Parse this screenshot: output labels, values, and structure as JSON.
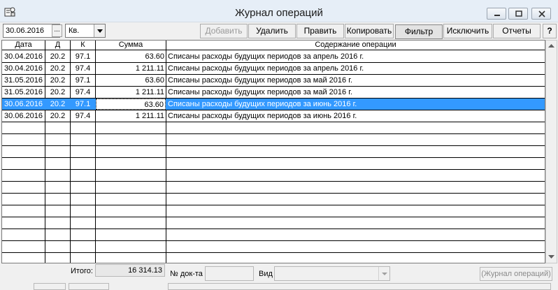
{
  "window": {
    "title": "Журнал операций"
  },
  "toolbar": {
    "date_value": "30.06.2016",
    "dots_label": "...",
    "period_value": "Кв.",
    "buttons": [
      "Добавить",
      "Удалить",
      "Править",
      "Копировать",
      "Фильтр",
      "Исключить",
      "Отчеты"
    ],
    "help_label": "?"
  },
  "grid": {
    "columns": [
      "Дата",
      "Д",
      "К",
      "Сумма",
      "Содержание операции"
    ],
    "rows": [
      {
        "date": "30.04.2016",
        "d": "20.2",
        "k": "97.1",
        "sum": "63.60",
        "text": "Списаны расходы будущих периодов за апрель 2016 г."
      },
      {
        "date": "30.04.2016",
        "d": "20.2",
        "k": "97.4",
        "sum": "1 211.11",
        "text": "Списаны расходы будущих периодов за апрель 2016 г."
      },
      {
        "date": "31.05.2016",
        "d": "20.2",
        "k": "97.1",
        "sum": "63.60",
        "text": "Списаны расходы будущих периодов за май 2016 г."
      },
      {
        "date": "31.05.2016",
        "d": "20.2",
        "k": "97.4",
        "sum": "1 211.11",
        "text": "Списаны расходы будущих периодов за май 2016 г."
      },
      {
        "date": "30.06.2016",
        "d": "20.2",
        "k": "97.1",
        "sum": "63.60",
        "text": "Списаны расходы будущих периодов за июнь 2016 г."
      },
      {
        "date": "30.06.2016",
        "d": "20.2",
        "k": "97.4",
        "sum": "1 211.11",
        "text": "Списаны расходы будущих периодов за июнь 2016 г."
      }
    ],
    "selected_row": 4
  },
  "footer": {
    "total_label": "Итого:",
    "total_value": "16 314.13",
    "doc_label": "№ док-та",
    "kind_label": "Вид",
    "journal_button": "(Журнал операций)"
  },
  "colors": {
    "selection": "#3399ff",
    "titlebar": "#e6eef7"
  }
}
